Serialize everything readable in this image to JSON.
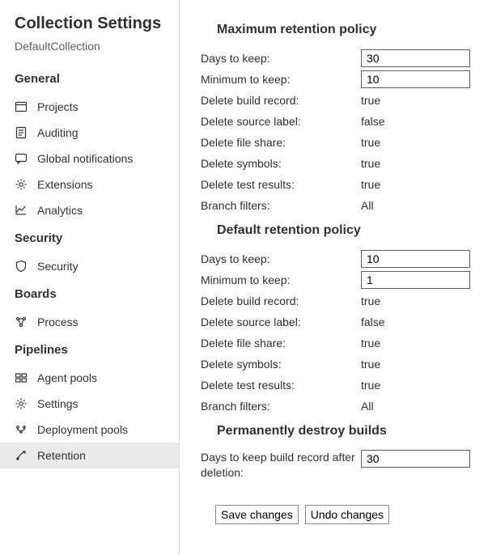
{
  "sidebar": {
    "title": "Collection Settings",
    "subtitle": "DefaultCollection",
    "sections": {
      "general": {
        "label": "General",
        "items": [
          {
            "label": "Projects"
          },
          {
            "label": "Auditing"
          },
          {
            "label": "Global notifications"
          },
          {
            "label": "Extensions"
          },
          {
            "label": "Analytics"
          }
        ]
      },
      "security": {
        "label": "Security",
        "items": [
          {
            "label": "Security"
          }
        ]
      },
      "boards": {
        "label": "Boards",
        "items": [
          {
            "label": "Process"
          }
        ]
      },
      "pipelines": {
        "label": "Pipelines",
        "items": [
          {
            "label": "Agent pools"
          },
          {
            "label": "Settings"
          },
          {
            "label": "Deployment pools"
          },
          {
            "label": "Retention"
          }
        ]
      }
    }
  },
  "main": {
    "max_retention": {
      "title": "Maximum retention policy",
      "days_to_keep_label": "Days to keep:",
      "days_to_keep_value": "30",
      "min_to_keep_label": "Minimum to keep:",
      "min_to_keep_value": "10",
      "delete_build_record_label": "Delete build record:",
      "delete_build_record_value": "true",
      "delete_source_label_label": "Delete source label:",
      "delete_source_label_value": "false",
      "delete_file_share_label": "Delete file share:",
      "delete_file_share_value": "true",
      "delete_symbols_label": "Delete symbols:",
      "delete_symbols_value": "true",
      "delete_test_results_label": "Delete test results:",
      "delete_test_results_value": "true",
      "branch_filters_label": "Branch filters:",
      "branch_filters_value": "All"
    },
    "default_retention": {
      "title": "Default retention policy",
      "days_to_keep_label": "Days to keep:",
      "days_to_keep_value": "10",
      "min_to_keep_label": "Minimum to keep:",
      "min_to_keep_value": "1",
      "delete_build_record_label": "Delete build record:",
      "delete_build_record_value": "true",
      "delete_source_label_label": "Delete source label:",
      "delete_source_label_value": "false",
      "delete_file_share_label": "Delete file share:",
      "delete_file_share_value": "true",
      "delete_symbols_label": "Delete symbols:",
      "delete_symbols_value": "true",
      "delete_test_results_label": "Delete test results:",
      "delete_test_results_value": "true",
      "branch_filters_label": "Branch filters:",
      "branch_filters_value": "All"
    },
    "destroy": {
      "title": "Permanently destroy builds",
      "days_label": "Days to keep build record after deletion:",
      "days_value": "30"
    },
    "buttons": {
      "save": "Save changes",
      "undo": "Undo changes"
    }
  }
}
